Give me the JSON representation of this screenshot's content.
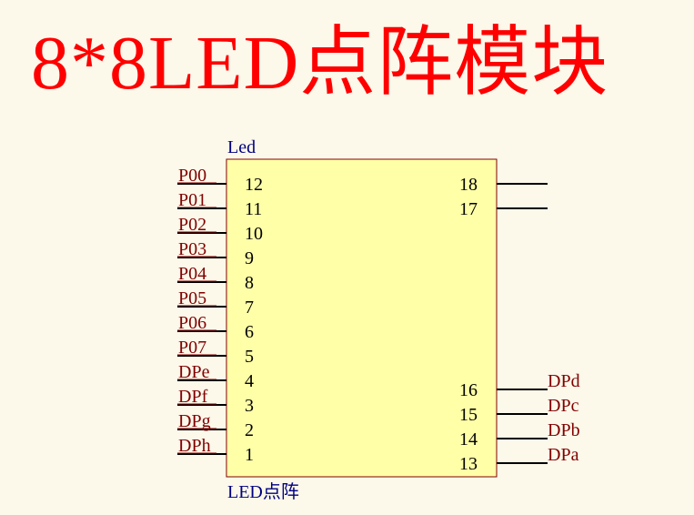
{
  "title": "8*8LED点阵模块",
  "component": {
    "designator": "Led",
    "comment": "LED点阵",
    "body_fill": "#ffffa8",
    "body_stroke": "#800000",
    "left_pins": [
      {
        "num": "12",
        "net": "P00"
      },
      {
        "num": "11",
        "net": "P01"
      },
      {
        "num": "10",
        "net": "P02"
      },
      {
        "num": "9",
        "net": "P03"
      },
      {
        "num": "8",
        "net": "P04"
      },
      {
        "num": "7",
        "net": "P05"
      },
      {
        "num": "6",
        "net": "P06"
      },
      {
        "num": "5",
        "net": "P07"
      },
      {
        "num": "4",
        "net": "DPe"
      },
      {
        "num": "3",
        "net": "DPf"
      },
      {
        "num": "2",
        "net": "DPg"
      },
      {
        "num": "1",
        "net": "DPh"
      }
    ],
    "right_pins_top": [
      {
        "num": "18",
        "net": ""
      },
      {
        "num": "17",
        "net": ""
      }
    ],
    "right_pins_bottom": [
      {
        "num": "16",
        "net": "DPd"
      },
      {
        "num": "15",
        "net": "DPc"
      },
      {
        "num": "14",
        "net": "DPb"
      },
      {
        "num": "13",
        "net": "DPa"
      }
    ]
  },
  "colors": {
    "title": "#ff0000",
    "net_label": "#800000",
    "component_label": "#000080",
    "pin_number": "#000000",
    "background": "#fcf8ea"
  }
}
